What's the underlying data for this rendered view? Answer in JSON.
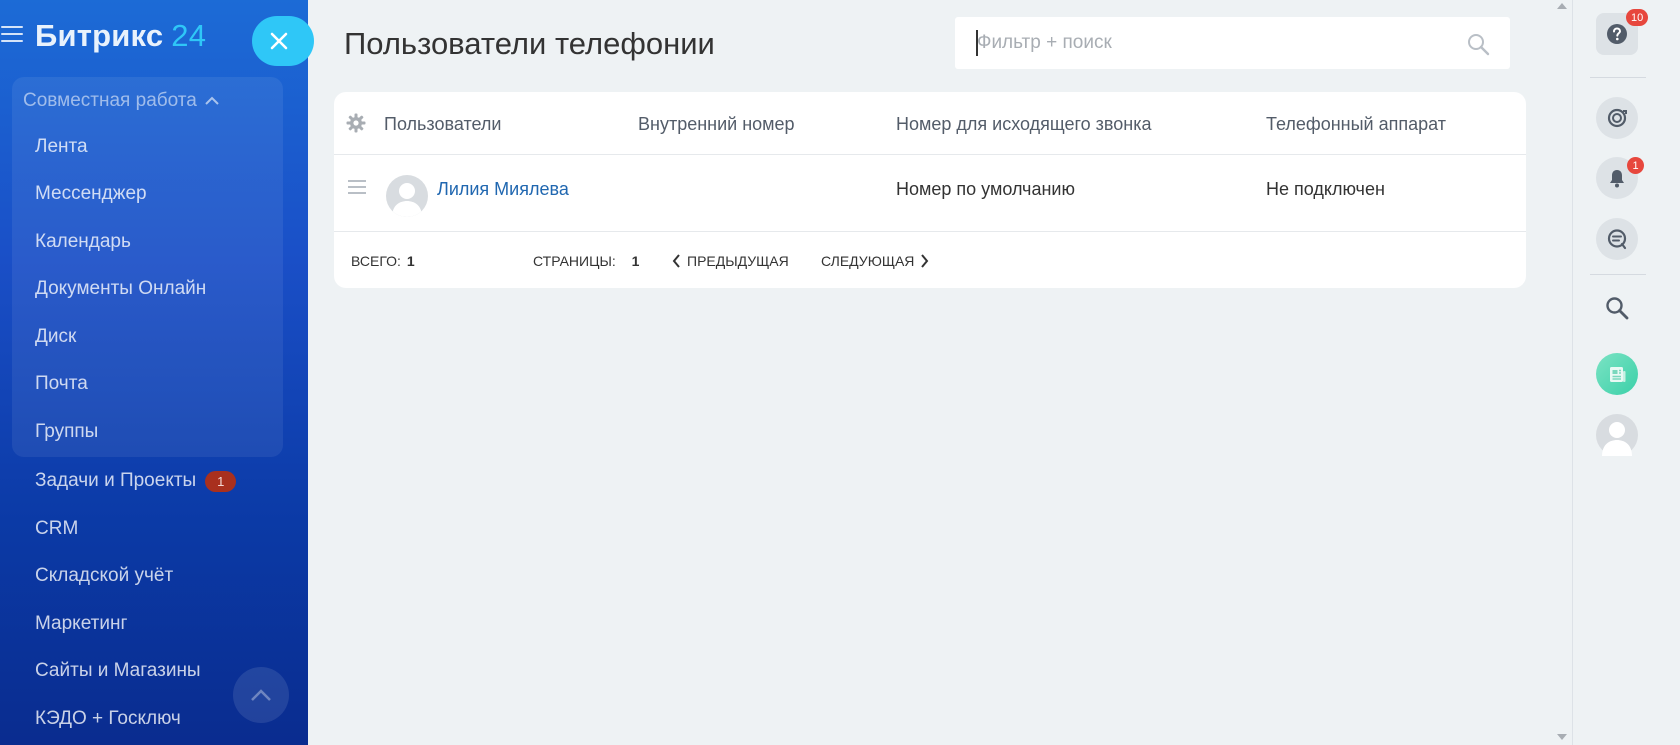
{
  "sidebar": {
    "logo_name": "Битрикс",
    "logo_number": "24",
    "group_title": "Совместная работа",
    "group_items": [
      {
        "label": "Лента"
      },
      {
        "label": "Мессенджер"
      },
      {
        "label": "Календарь"
      },
      {
        "label": "Документы Онлайн"
      },
      {
        "label": "Диск"
      },
      {
        "label": "Почта"
      },
      {
        "label": "Группы"
      }
    ],
    "items": [
      {
        "label": "Задачи и Проекты",
        "badge": "1"
      },
      {
        "label": "CRM"
      },
      {
        "label": "Складской учёт"
      },
      {
        "label": "Маркетинг"
      },
      {
        "label": "Сайты и Магазины"
      },
      {
        "label": "КЭДО + Госключ"
      }
    ]
  },
  "page": {
    "title": "Пользователи телефонии",
    "search_placeholder": "Фильтр + поиск"
  },
  "table": {
    "columns": [
      "Пользователи",
      "Внутренний номер",
      "Номер для исходящего звонка",
      "Телефонный аппарат"
    ],
    "rows": [
      {
        "user": "Лилия Миялева",
        "internal": "",
        "outgoing": "Номер по умолчанию",
        "device": "Не подключен"
      }
    ],
    "footer": {
      "total_label": "ВСЕГО:",
      "total_value": "1",
      "pages_label": "СТРАНИЦЫ:",
      "pages_value": "1",
      "prev": "ПРЕДЫДУЩАЯ",
      "next": "СЛЕДУЮЩАЯ"
    }
  },
  "rail": {
    "help_badge": "10",
    "notifications_badge": "1"
  },
  "colors": {
    "accent": "#2fc7f7",
    "link": "#2067b0",
    "badge": "#e7473d"
  }
}
